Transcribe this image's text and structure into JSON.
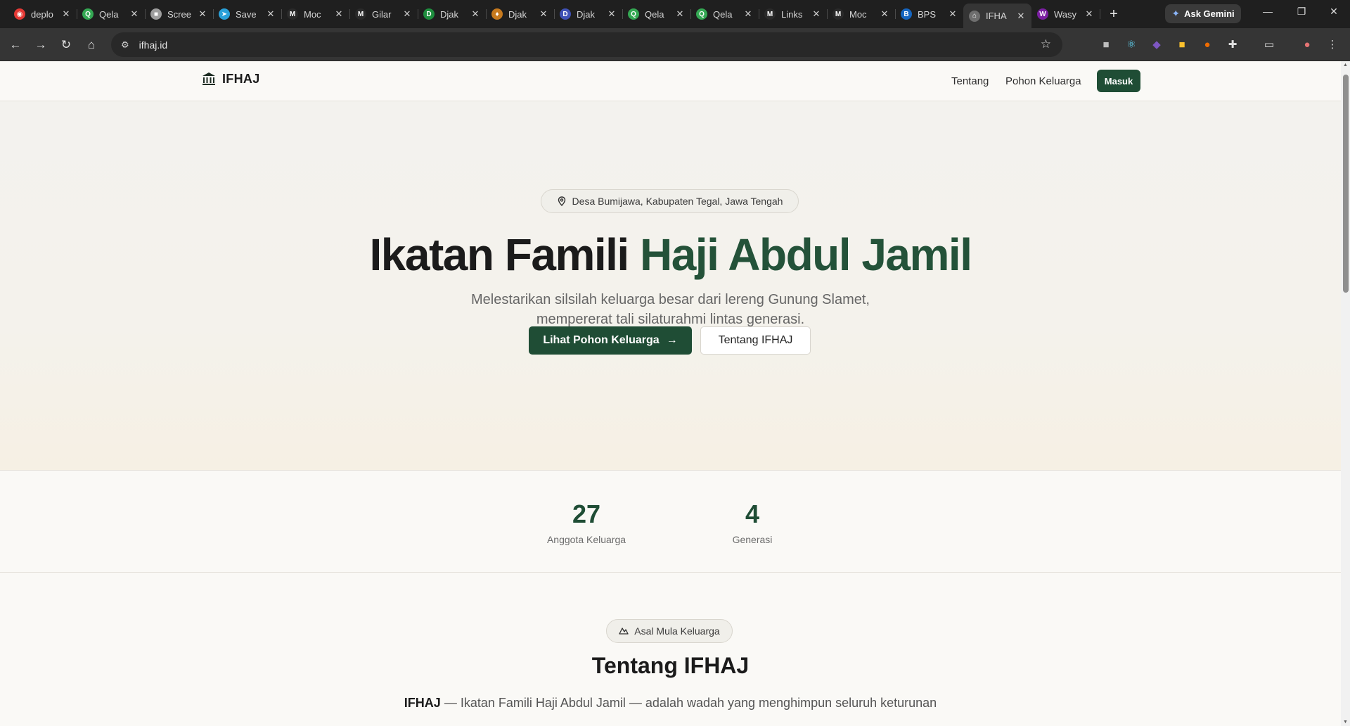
{
  "browser": {
    "tabs": [
      {
        "title": "deplo",
        "icon": "app-icon",
        "color": "#e53935",
        "glyph": "◉"
      },
      {
        "title": "Qela",
        "icon": "q-icon",
        "color": "#34a853",
        "glyph": "Q"
      },
      {
        "title": "Scree",
        "icon": "camera-icon",
        "color": "#9e9e9e",
        "glyph": "■"
      },
      {
        "title": "Save",
        "icon": "telegram-icon",
        "color": "#2aa1da",
        "glyph": "➤"
      },
      {
        "title": "Moc",
        "icon": "medium-icon",
        "color": "#2a2a2a",
        "glyph": "M"
      },
      {
        "title": "Gilar",
        "icon": "medium-icon",
        "color": "#2a2a2a",
        "glyph": "M"
      },
      {
        "title": "Djak",
        "icon": "dg-icon",
        "color": "#1e8e3e",
        "glyph": "D"
      },
      {
        "title": "Djak",
        "icon": "garuda-icon",
        "color": "#c77a1e",
        "glyph": "♦"
      },
      {
        "title": "Djak",
        "icon": "d-icon",
        "color": "#3f51b5",
        "glyph": "D"
      },
      {
        "title": "Qela",
        "icon": "q-icon",
        "color": "#34a853",
        "glyph": "Q"
      },
      {
        "title": "Qela",
        "icon": "q-icon",
        "color": "#34a853",
        "glyph": "Q"
      },
      {
        "title": "Links",
        "icon": "medium-icon",
        "color": "#2a2a2a",
        "glyph": "M"
      },
      {
        "title": "Moc",
        "icon": "medium-icon",
        "color": "#2a2a2a",
        "glyph": "M"
      },
      {
        "title": "BPS",
        "icon": "bps-icon",
        "color": "#1565c0",
        "glyph": "B"
      },
      {
        "title": "IFHA",
        "icon": "ifhaj-icon",
        "color": "#6e6e6e",
        "glyph": "⌂",
        "active": true
      },
      {
        "title": "Wasy",
        "icon": "wasy-icon",
        "color": "#7b1fa2",
        "glyph": "W"
      }
    ],
    "ask_gemini": "Ask Gemini",
    "url": "ifhaj.id"
  },
  "site": {
    "logo_text": "IFHAJ",
    "nav": {
      "about": "Tentang",
      "tree": "Pohon Keluarga",
      "login": "Masuk"
    }
  },
  "hero": {
    "location": "Desa Bumijawa, Kabupaten Tegal, Jawa Tengah",
    "title_main": "Ikatan Famili ",
    "title_accent": "Haji Abdul Jamil",
    "subtitle_line1": "Melestarikan silsilah keluarga besar dari lereng Gunung Slamet,",
    "subtitle_line2": "mempererat tali silaturahmi lintas generasi.",
    "cta_primary": "Lihat Pohon Keluarga",
    "cta_secondary": "Tentang IFHAJ"
  },
  "stats": [
    {
      "value": "27",
      "label": "Anggota Keluarga"
    },
    {
      "value": "4",
      "label": "Generasi"
    }
  ],
  "about": {
    "badge": "Asal Mula Keluarga",
    "title": "Tentang IFHAJ",
    "text_bold": "IFHAJ",
    "text_rest": " — Ikatan Famili Haji Abdul Jamil — adalah wadah yang menghimpun seluruh keturunan"
  },
  "colors": {
    "brand_green": "#1f4d35",
    "accent_green": "#245239",
    "page_bg": "#faf9f6"
  }
}
